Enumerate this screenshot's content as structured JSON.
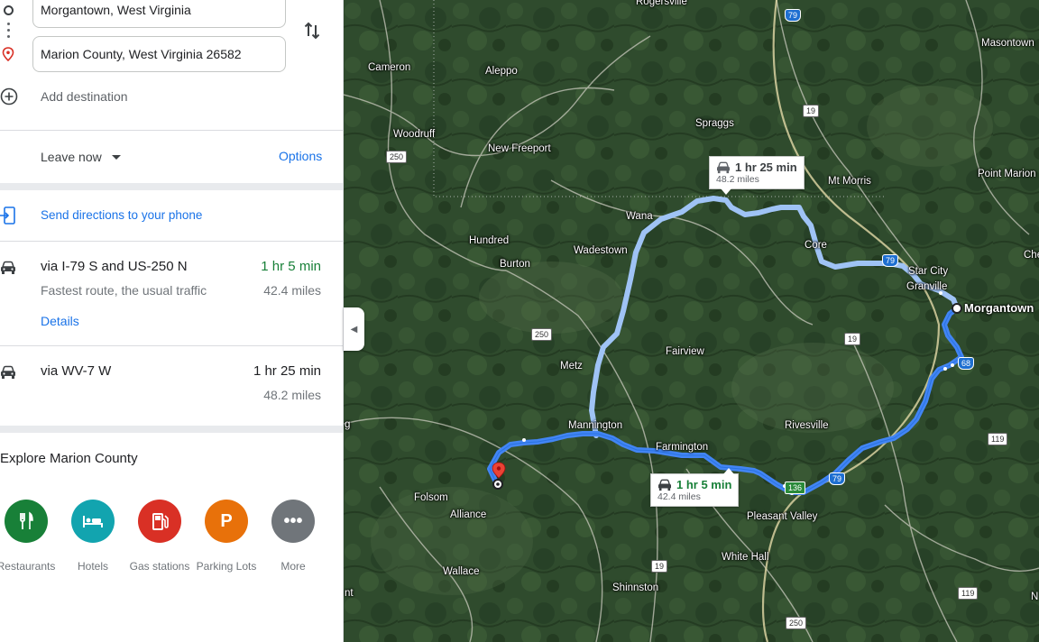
{
  "directions": {
    "origin": "Morgantown, West Virginia",
    "destination": "Marion County, West Virginia 26582",
    "add_destination": "Add destination",
    "leave_now": "Leave now",
    "options": "Options",
    "send_to_phone": "Send directions to your phone"
  },
  "routes": [
    {
      "title": "via I-79 S and US-250 N",
      "description": "Fastest route, the usual traffic",
      "time": "1 hr 5 min",
      "distance": "42.4 miles",
      "details": "Details"
    },
    {
      "title": "via WV-7 W",
      "time": "1 hr 25 min",
      "distance": "48.2 miles"
    }
  ],
  "explore": {
    "title": "Explore Marion County",
    "categories": [
      {
        "label": "Restaurants",
        "color": "#188038",
        "icon": "restaurant-icon"
      },
      {
        "label": "Hotels",
        "color": "#12a4af",
        "icon": "hotel-icon"
      },
      {
        "label": "Gas stations",
        "color": "#d93025",
        "icon": "gas-station-icon"
      },
      {
        "label": "Parking Lots",
        "color": "#e8710a",
        "icon": "parking-icon"
      },
      {
        "label": "More",
        "color": "#70757a",
        "icon": "more-icon"
      }
    ]
  },
  "map": {
    "callouts": [
      {
        "time": "1 hr 25 min",
        "distance": "48.2 miles"
      },
      {
        "time": "1 hr 5 min",
        "distance": "42.4 miles"
      }
    ],
    "places": {
      "rogersville": "Rogersville",
      "masontown": "Masontown",
      "cameron": "Cameron",
      "aleppo": "Aleppo",
      "spraggs": "Spraggs",
      "woodruff": "Woodruff",
      "new_freeport": "New Freeport",
      "mt_morris": "Mt Morris",
      "point_marion": "Point Marion",
      "wana": "Wana",
      "hundred": "Hundred",
      "wadestown": "Wadestown",
      "core": "Core",
      "burton": "Burton",
      "star_city": "Star City",
      "granville": "Granville",
      "morgantown": "Morgantown",
      "che": "Che",
      "fairview": "Fairview",
      "metz": "Metz",
      "mannington": "Mannington",
      "rivesville": "Rivesville",
      "farmington": "Farmington",
      "folsom": "Folsom",
      "alliance": "Alliance",
      "pleasant_valley": "Pleasant Valley",
      "white_hall": "White Hall",
      "wallace": "Wallace",
      "shinnston": "Shinnston",
      "g": "g",
      "nt": "nt",
      "n": "N"
    },
    "shields": {
      "i79_top": "79",
      "us19_top": "19",
      "us250_left": "250",
      "i79_right": "79",
      "us250_mid": "250",
      "us19_mid": "19",
      "i68": "68",
      "us119": "119",
      "wv136": "136",
      "i79_bottom": "79",
      "us19_bottom": "19",
      "us119_bottom": "119",
      "us250_bottom": "250"
    },
    "colors": {
      "primary_route": "#4285f4",
      "alt_route": "#9fc3f5",
      "destination_pin": "#ea4335"
    }
  }
}
